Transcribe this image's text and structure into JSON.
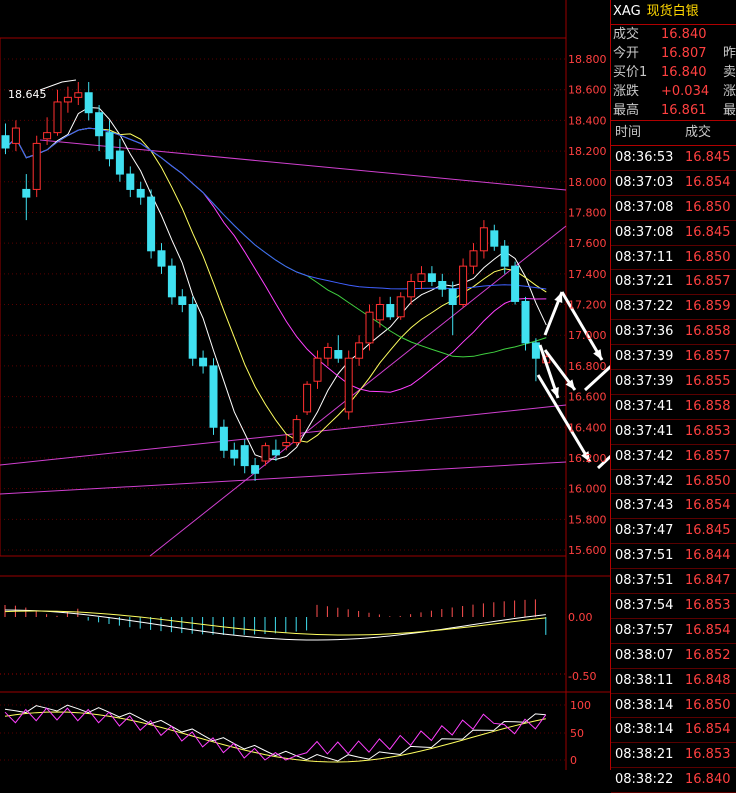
{
  "header": {
    "symbol": "XAG",
    "name": "现货白银"
  },
  "quote": [
    {
      "label": "成交",
      "value": "16.840",
      "extra": ""
    },
    {
      "label": "今开",
      "value": "16.807",
      "extra": "昨"
    },
    {
      "label": "买价1",
      "value": "16.840",
      "extra": "卖"
    },
    {
      "label": "涨跌",
      "value": "+0.034",
      "extra": "涨"
    },
    {
      "label": "最高",
      "value": "16.861",
      "extra": "最"
    }
  ],
  "ticks_header": {
    "time": "时间",
    "price": "成交"
  },
  "ticks": [
    {
      "time": "08:36:53",
      "price": "16.845"
    },
    {
      "time": "08:37:03",
      "price": "16.854"
    },
    {
      "time": "08:37:08",
      "price": "16.850"
    },
    {
      "time": "08:37:08",
      "price": "16.845"
    },
    {
      "time": "08:37:11",
      "price": "16.850"
    },
    {
      "time": "08:37:21",
      "price": "16.857"
    },
    {
      "time": "08:37:22",
      "price": "16.859"
    },
    {
      "time": "08:37:36",
      "price": "16.858"
    },
    {
      "time": "08:37:39",
      "price": "16.857"
    },
    {
      "time": "08:37:39",
      "price": "16.855"
    },
    {
      "time": "08:37:41",
      "price": "16.858"
    },
    {
      "time": "08:37:41",
      "price": "16.853"
    },
    {
      "time": "08:37:42",
      "price": "16.857"
    },
    {
      "time": "08:37:42",
      "price": "16.850"
    },
    {
      "time": "08:37:43",
      "price": "16.854"
    },
    {
      "time": "08:37:47",
      "price": "16.845"
    },
    {
      "time": "08:37:51",
      "price": "16.844"
    },
    {
      "time": "08:37:51",
      "price": "16.847"
    },
    {
      "time": "08:37:54",
      "price": "16.853"
    },
    {
      "time": "08:37:57",
      "price": "16.854"
    },
    {
      "time": "08:38:07",
      "price": "16.852"
    },
    {
      "time": "08:38:11",
      "price": "16.848"
    },
    {
      "time": "08:38:14",
      "price": "16.850"
    },
    {
      "time": "08:38:14",
      "price": "16.854"
    },
    {
      "time": "08:38:21",
      "price": "16.853"
    },
    {
      "time": "08:38:22",
      "price": "16.840"
    }
  ],
  "chart_data": {
    "type": "candlestick",
    "max_label": "18.645",
    "y_ticks": [
      "18.800",
      "18.600",
      "18.400",
      "18.200",
      "18.000",
      "17.800",
      "17.600",
      "17.400",
      "17.200",
      "17.000",
      "16.800",
      "16.600",
      "16.400",
      "16.200",
      "16.000",
      "15.800",
      "15.600"
    ],
    "ylim": [
      15.6,
      18.8
    ],
    "candles": [
      {
        "o": 18.3,
        "h": 18.38,
        "l": 18.18,
        "c": 18.22
      },
      {
        "o": 18.25,
        "h": 18.4,
        "l": 18.2,
        "c": 18.35
      },
      {
        "o": 17.95,
        "h": 18.05,
        "l": 17.75,
        "c": 17.9
      },
      {
        "o": 17.95,
        "h": 18.3,
        "l": 17.9,
        "c": 18.25
      },
      {
        "o": 18.28,
        "h": 18.42,
        "l": 18.24,
        "c": 18.32
      },
      {
        "o": 18.32,
        "h": 18.6,
        "l": 18.3,
        "c": 18.52
      },
      {
        "o": 18.52,
        "h": 18.62,
        "l": 18.45,
        "c": 18.55
      },
      {
        "o": 18.55,
        "h": 18.65,
        "l": 18.5,
        "c": 18.58
      },
      {
        "o": 18.58,
        "h": 18.65,
        "l": 18.4,
        "c": 18.45
      },
      {
        "o": 18.45,
        "h": 18.5,
        "l": 18.2,
        "c": 18.3
      },
      {
        "o": 18.32,
        "h": 18.4,
        "l": 18.1,
        "c": 18.15
      },
      {
        "o": 18.2,
        "h": 18.28,
        "l": 18.0,
        "c": 18.05
      },
      {
        "o": 18.05,
        "h": 18.1,
        "l": 17.9,
        "c": 17.95
      },
      {
        "o": 17.95,
        "h": 18.0,
        "l": 17.85,
        "c": 17.9
      },
      {
        "o": 17.9,
        "h": 17.95,
        "l": 17.5,
        "c": 17.55
      },
      {
        "o": 17.55,
        "h": 17.6,
        "l": 17.4,
        "c": 17.45
      },
      {
        "o": 17.45,
        "h": 17.5,
        "l": 17.2,
        "c": 17.25
      },
      {
        "o": 17.25,
        "h": 17.3,
        "l": 17.15,
        "c": 17.2
      },
      {
        "o": 17.2,
        "h": 17.25,
        "l": 16.8,
        "c": 16.85
      },
      {
        "o": 16.85,
        "h": 16.9,
        "l": 16.75,
        "c": 16.8
      },
      {
        "o": 16.8,
        "h": 16.85,
        "l": 16.35,
        "c": 16.4
      },
      {
        "o": 16.4,
        "h": 16.45,
        "l": 16.2,
        "c": 16.25
      },
      {
        "o": 16.25,
        "h": 16.3,
        "l": 16.15,
        "c": 16.2
      },
      {
        "o": 16.28,
        "h": 16.32,
        "l": 16.1,
        "c": 16.15
      },
      {
        "o": 16.15,
        "h": 16.2,
        "l": 16.05,
        "c": 16.1
      },
      {
        "o": 16.18,
        "h": 16.3,
        "l": 16.15,
        "c": 16.28
      },
      {
        "o": 16.25,
        "h": 16.32,
        "l": 16.18,
        "c": 16.22
      },
      {
        "o": 16.28,
        "h": 16.35,
        "l": 16.25,
        "c": 16.3
      },
      {
        "o": 16.3,
        "h": 16.48,
        "l": 16.28,
        "c": 16.45
      },
      {
        "o": 16.5,
        "h": 16.7,
        "l": 16.48,
        "c": 16.68
      },
      {
        "o": 16.7,
        "h": 16.9,
        "l": 16.65,
        "c": 16.85
      },
      {
        "o": 16.85,
        "h": 16.95,
        "l": 16.8,
        "c": 16.92
      },
      {
        "o": 16.9,
        "h": 17.0,
        "l": 16.82,
        "c": 16.85
      },
      {
        "o": 16.5,
        "h": 16.9,
        "l": 16.45,
        "c": 16.85
      },
      {
        "o": 16.85,
        "h": 17.0,
        "l": 16.8,
        "c": 16.95
      },
      {
        "o": 16.95,
        "h": 17.2,
        "l": 16.9,
        "c": 17.15
      },
      {
        "o": 17.1,
        "h": 17.25,
        "l": 17.05,
        "c": 17.2
      },
      {
        "o": 17.2,
        "h": 17.25,
        "l": 17.1,
        "c": 17.12
      },
      {
        "o": 17.12,
        "h": 17.28,
        "l": 17.1,
        "c": 17.25
      },
      {
        "o": 17.25,
        "h": 17.4,
        "l": 17.2,
        "c": 17.35
      },
      {
        "o": 17.35,
        "h": 17.45,
        "l": 17.3,
        "c": 17.4
      },
      {
        "o": 17.4,
        "h": 17.45,
        "l": 17.32,
        "c": 17.35
      },
      {
        "o": 17.35,
        "h": 17.4,
        "l": 17.25,
        "c": 17.3
      },
      {
        "o": 17.3,
        "h": 17.35,
        "l": 17.0,
        "c": 17.2
      },
      {
        "o": 17.2,
        "h": 17.5,
        "l": 17.18,
        "c": 17.45
      },
      {
        "o": 17.45,
        "h": 17.6,
        "l": 17.4,
        "c": 17.55
      },
      {
        "o": 17.55,
        "h": 17.75,
        "l": 17.5,
        "c": 17.7
      },
      {
        "o": 17.68,
        "h": 17.72,
        "l": 17.55,
        "c": 17.58
      },
      {
        "o": 17.58,
        "h": 17.62,
        "l": 17.4,
        "c": 17.45
      },
      {
        "o": 17.45,
        "h": 17.48,
        "l": 17.2,
        "c": 17.22
      },
      {
        "o": 17.22,
        "h": 17.25,
        "l": 16.9,
        "c": 16.95
      },
      {
        "o": 16.95,
        "h": 16.98,
        "l": 16.7,
        "c": 16.85
      },
      {
        "o": 16.82,
        "h": 16.88,
        "l": 16.8,
        "c": 16.86
      }
    ],
    "macd_ticks": [
      "0.00",
      "-0.50"
    ],
    "kdj_ticks": [
      "100",
      "50",
      "0"
    ]
  }
}
